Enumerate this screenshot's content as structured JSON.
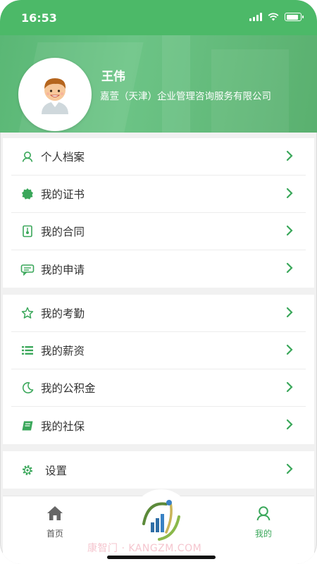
{
  "status": {
    "time": "16:53"
  },
  "profile": {
    "name": "王伟",
    "company": "嘉萱（天津）企业管理咨询服务有限公司"
  },
  "colors": {
    "accent": "#4cb968",
    "icon": "#3aa75a",
    "text": "#333333"
  },
  "menu_group1": [
    {
      "label": "个人档案",
      "icon": "person-outline-icon"
    },
    {
      "label": "我的证书",
      "icon": "certificate-badge-icon"
    },
    {
      "label": "我的合同",
      "icon": "contract-document-icon"
    },
    {
      "label": "我的申请",
      "icon": "application-chat-icon"
    }
  ],
  "menu_group2": [
    {
      "label": "我的考勤",
      "icon": "star-outline-icon"
    },
    {
      "label": "我的薪资",
      "icon": "list-icon"
    },
    {
      "label": "我的公积金",
      "icon": "moon-icon"
    },
    {
      "label": "我的社保",
      "icon": "book-icon"
    }
  ],
  "menu_group3": [
    {
      "label": "设置",
      "icon": "gear-icon"
    }
  ],
  "tabbar": {
    "home_label": "首页",
    "mine_label": "我的",
    "watermark": "康智门 · KANGZM.COM"
  }
}
